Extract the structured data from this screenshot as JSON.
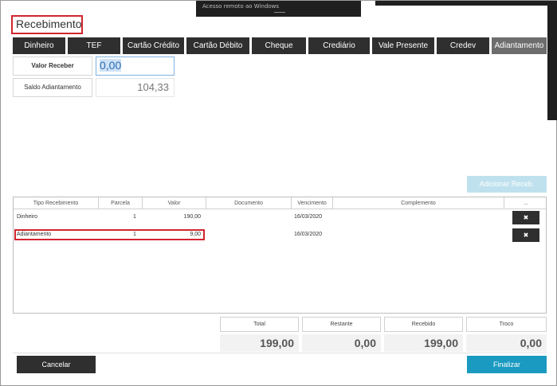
{
  "window": {
    "title": "Recebimento",
    "topbar_text": "Acesso remoto ao Windows"
  },
  "tabs": [
    "Dinheiro",
    "TEF",
    "Cartão Crédito",
    "Cartão Débito",
    "Cheque",
    "Crediário",
    "Vale Presente",
    "Credev",
    "Adiantamento"
  ],
  "form": {
    "valor_receber_label": "Valor Receber",
    "valor_receber_value": "0,00",
    "saldo_label": "Saldo Adiantamento",
    "saldo_value": "104,33"
  },
  "add_button": "Adicionar Receb.",
  "grid": {
    "headers": [
      "Tipo Recebimento",
      "Parcela",
      "Valor",
      "Documento",
      "Vencimento",
      "Complemento",
      "..."
    ],
    "rows": [
      {
        "tipo": "Dinheiro",
        "parcela": "1",
        "valor": "190,00",
        "documento": "",
        "vencimento": "16/03/2020",
        "complemento": ""
      },
      {
        "tipo": "Adiantamento",
        "parcela": "1",
        "valor": "9,00",
        "documento": "",
        "vencimento": "16/03/2020",
        "complemento": ""
      }
    ],
    "delete_icon": "close-icon"
  },
  "totals": {
    "labels": [
      "Total",
      "Restante",
      "Recebido",
      "Troco"
    ],
    "values": [
      "199,00",
      "0,00",
      "199,00",
      "0,00"
    ]
  },
  "buttons": {
    "cancel": "Cancelar",
    "finalizar": "Finalizar"
  }
}
